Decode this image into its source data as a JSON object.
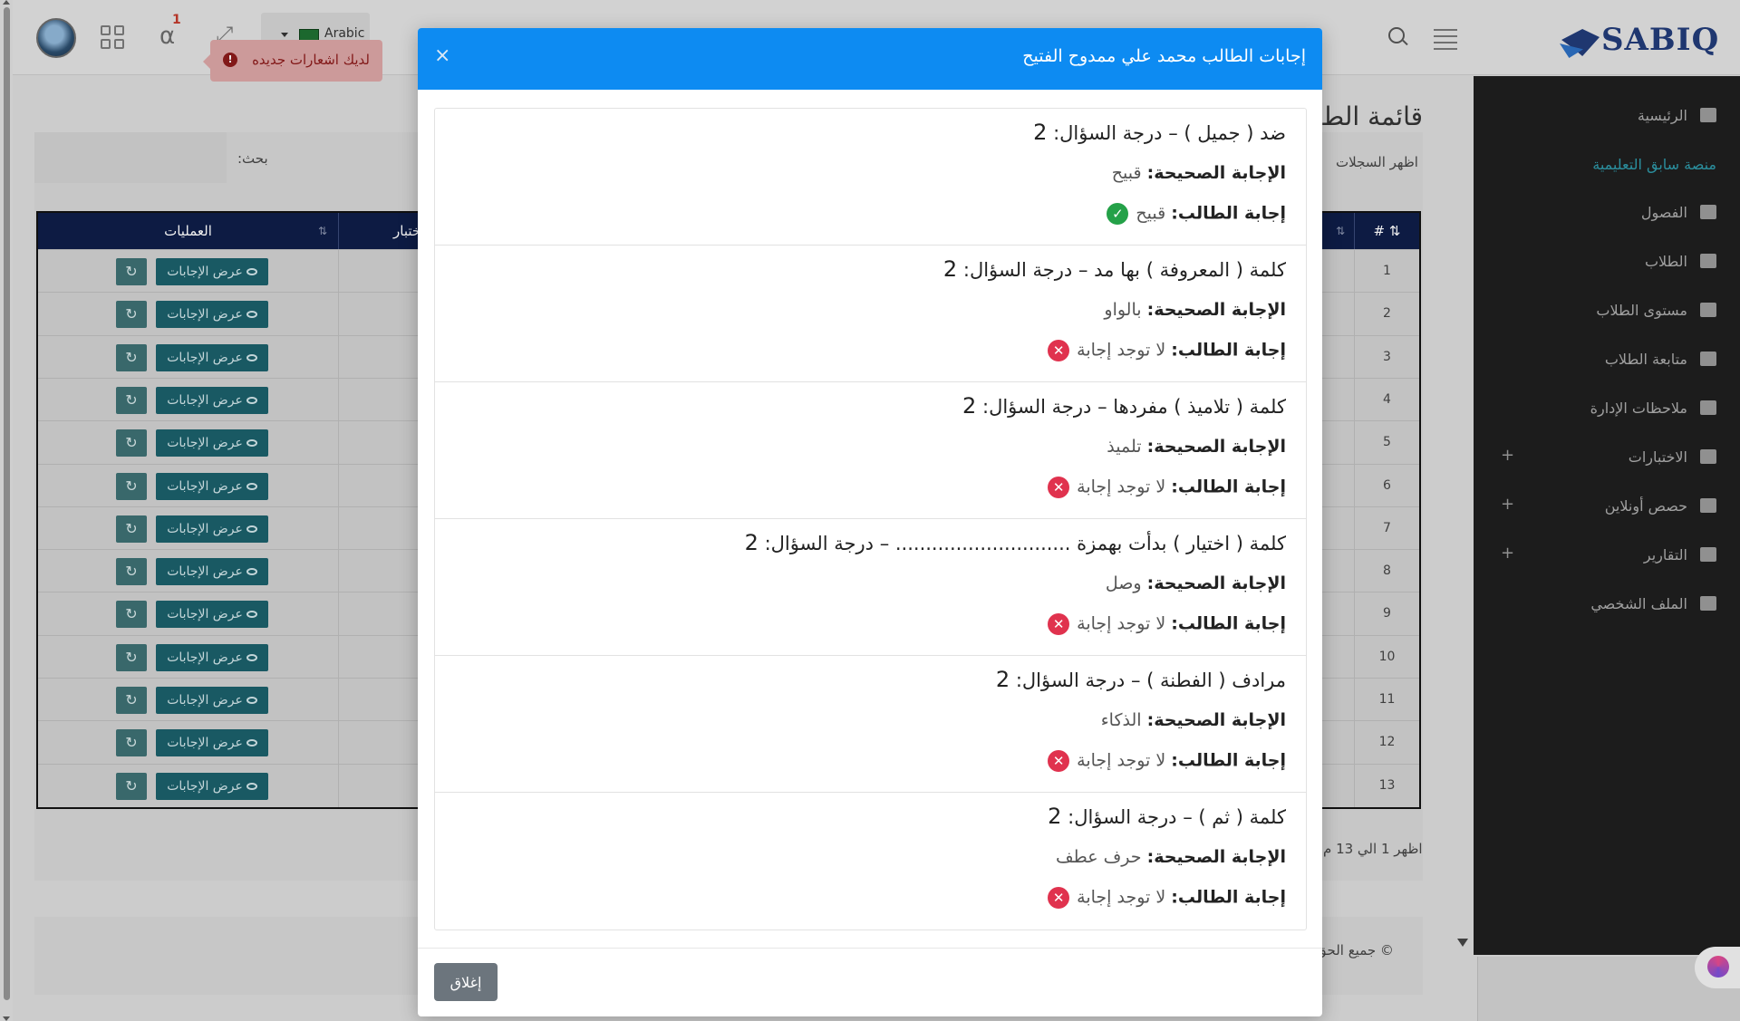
{
  "header": {
    "language": "Arabic",
    "notification_count": "1",
    "notification_tip": "لديك اشعارات جديده",
    "logo_text": "SABIQ"
  },
  "sidebar": {
    "items": [
      {
        "label": "الرئيسية",
        "icon": "home-icon"
      },
      {
        "label": "منصة سابق التعليمية",
        "icon": ""
      },
      {
        "label": "الفصول",
        "icon": "monitor-icon"
      },
      {
        "label": "الطلاب",
        "icon": "student-icon"
      },
      {
        "label": "مستوى الطلاب",
        "icon": "student-icon"
      },
      {
        "label": "متابعة الطلاب",
        "icon": "student-icon"
      },
      {
        "label": "ملاحظات الإدارة",
        "icon": "notebook-icon"
      },
      {
        "label": "الاختبارات",
        "icon": "monitor-icon"
      },
      {
        "label": "حصص أونلاين",
        "icon": "video-icon"
      },
      {
        "label": "التقارير",
        "icon": "monitor-icon"
      },
      {
        "label": "الملف الشخصي",
        "icon": "id-card-icon"
      }
    ],
    "expandable_plus": "+"
  },
  "page": {
    "title": "قائمة الط",
    "search_label": "بحث:",
    "show_records": "اظهر السجلات",
    "table_headers": {
      "ops": "العمليات",
      "exam": "ختبار",
      "num": "#"
    },
    "rows": [
      "1",
      "2",
      "3",
      "4",
      "5",
      "6",
      "7",
      "8",
      "9",
      "10",
      "11",
      "12",
      "13"
    ],
    "view_answers": "عرض الإجابات",
    "footer_info": "اظهر 1 الي 13 م",
    "copyright": "© جميع الحق"
  },
  "modal": {
    "title": "إجابات الطالب محمد علي ممدوح الفتيح",
    "close_x": "×",
    "correct_label": "الإجابة الصحيحة:",
    "student_label": "إجابة الطالب:",
    "grade_label": "درجة السؤال:",
    "close_button": "إغلاق",
    "questions": [
      {
        "text": "ضد ( جميل ) –",
        "grade": "2",
        "correct": "قبيح",
        "student": "قبيح",
        "status": "correct"
      },
      {
        "text": "كلمة ( المعروفة ) بها مد –",
        "grade": "2",
        "correct": "بالواو",
        "student": "لا توجد إجابة",
        "status": "wrong"
      },
      {
        "text": "كلمة ( تلاميذ ) مفردها –",
        "grade": "2",
        "correct": "تلميذ",
        "student": "لا توجد إجابة",
        "status": "wrong"
      },
      {
        "text": "كلمة ( اختيار ) بدأت بهمزة ............................. –",
        "grade": "2",
        "correct": "وصل",
        "student": "لا توجد إجابة",
        "status": "wrong"
      },
      {
        "text": "مرادف ( الفطنة ) –",
        "grade": "2",
        "correct": "الذكاء",
        "student": "لا توجد إجابة",
        "status": "wrong"
      },
      {
        "text": "كلمة ( ثم ) –",
        "grade": "2",
        "correct": "حرف عطف",
        "student": "لا توجد إجابة",
        "status": "wrong"
      }
    ]
  },
  "colors": {
    "modal_header": "#0d8bf2",
    "correct": "#24a148",
    "wrong": "#e0324e",
    "sidebar_active": "#2e98a8"
  }
}
